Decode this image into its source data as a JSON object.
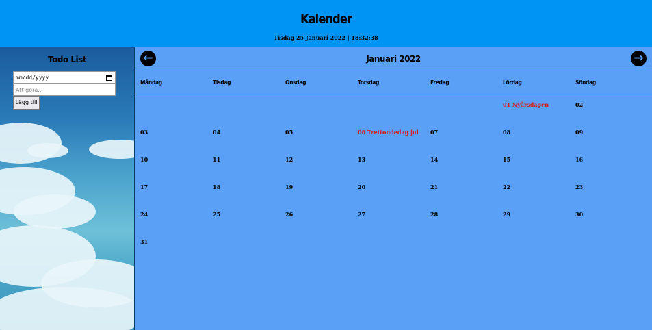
{
  "header": {
    "title": "Kalender",
    "datetime": "Tisdag 25 Januari 2022 | 18:32:38"
  },
  "sidebar": {
    "title": "Todo List",
    "date_placeholder": "mm/dd/yyyy",
    "todo_placeholder": "Att göra...",
    "add_button": "Lägg till"
  },
  "calendar": {
    "month_title": "Januari 2022",
    "prev_icon": "arrow-left-icon",
    "next_icon": "arrow-right-icon",
    "weekdays": [
      "Måndag",
      "Tisdag",
      "Onsdag",
      "Torsdag",
      "Fredag",
      "Lördag",
      "Söndag"
    ],
    "weeks": [
      [
        "",
        "",
        "",
        "",
        "",
        "01 Nyårsdagen",
        "02"
      ],
      [
        "03",
        "04",
        "05",
        "06 Trettondedag jul",
        "07",
        "08",
        "09"
      ],
      [
        "10",
        "11",
        "12",
        "13",
        "14",
        "15",
        "16"
      ],
      [
        "17",
        "18",
        "19",
        "20",
        "21",
        "22",
        "23"
      ],
      [
        "24",
        "25",
        "26",
        "27",
        "28",
        "29",
        "30"
      ],
      [
        "31",
        "",
        "",
        "",
        "",
        "",
        ""
      ]
    ],
    "holidays": [
      "01 Nyårsdagen",
      "06 Trettondedag jul"
    ],
    "colors": {
      "header_bg": "#0095f5",
      "calendar_bg": "#5aa0f6",
      "holiday": "#d81b1b"
    }
  }
}
